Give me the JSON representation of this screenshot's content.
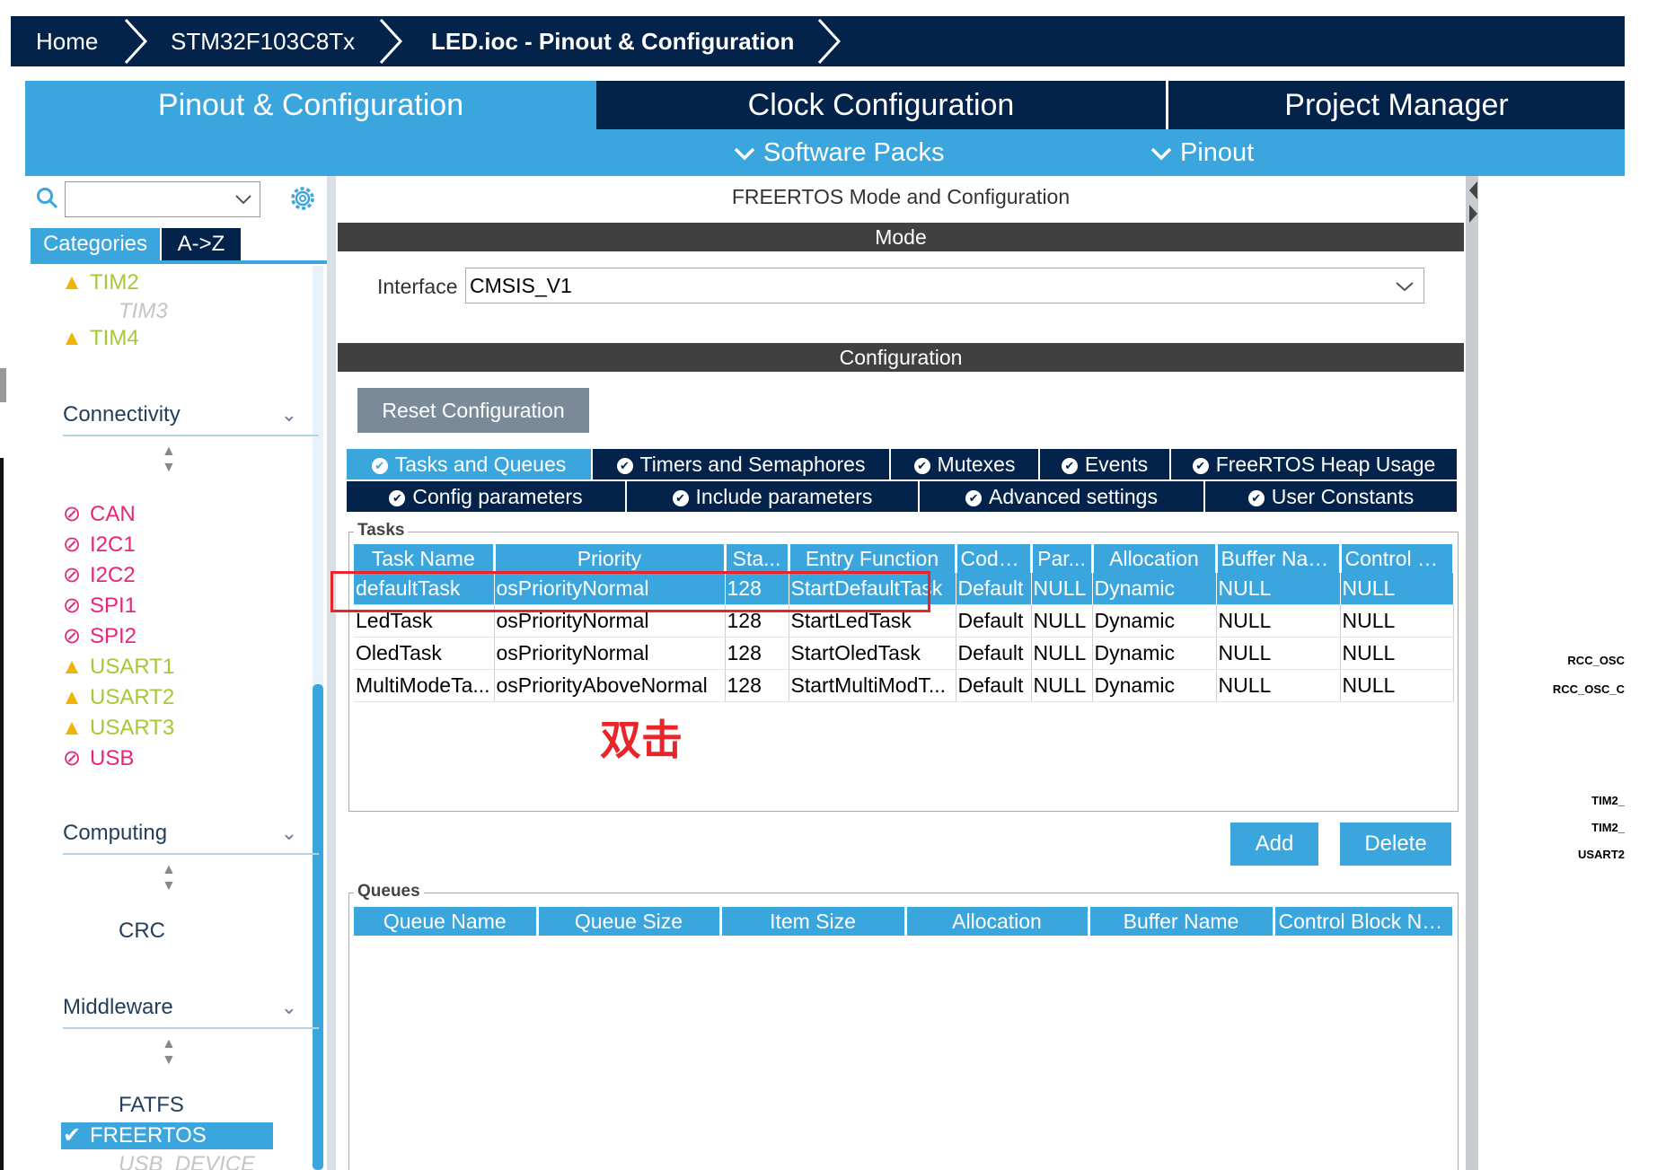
{
  "breadcrumb": [
    "Home",
    "STM32F103C8Tx",
    "LED.ioc - Pinout & Configuration"
  ],
  "top_tabs": [
    "Pinout & Configuration",
    "Clock Configuration",
    "Project Manager"
  ],
  "sub_menu": [
    "Software Packs",
    "Pinout"
  ],
  "left": {
    "search_value": "",
    "category_tabs": [
      "Categories",
      "A->Z"
    ],
    "timers": [
      {
        "label": "TIM2",
        "state": "warning"
      },
      {
        "label": "TIM3",
        "state": "disabled"
      },
      {
        "label": "TIM4",
        "state": "warning"
      }
    ],
    "sections": {
      "connectivity": "Connectivity",
      "computing": "Computing",
      "middleware": "Middleware"
    },
    "connectivity": [
      {
        "label": "CAN",
        "state": "blocked"
      },
      {
        "label": "I2C1",
        "state": "blocked"
      },
      {
        "label": "I2C2",
        "state": "blocked"
      },
      {
        "label": "SPI1",
        "state": "blocked"
      },
      {
        "label": "SPI2",
        "state": "blocked"
      },
      {
        "label": "USART1",
        "state": "warning"
      },
      {
        "label": "USART2",
        "state": "warning"
      },
      {
        "label": "USART3",
        "state": "warning"
      },
      {
        "label": "USB",
        "state": "blocked"
      }
    ],
    "computing": [
      "CRC"
    ],
    "middleware": [
      {
        "label": "FATFS",
        "state": "normal"
      },
      {
        "label": "FREERTOS",
        "state": "selected"
      },
      {
        "label": "USB_DEVICE",
        "state": "disabled"
      }
    ]
  },
  "main": {
    "title": "FREERTOS Mode and Configuration",
    "mode_header": "Mode",
    "interface_label": "Interface",
    "interface_value": "CMSIS_V1",
    "config_header": "Configuration",
    "reset_button": "Reset Configuration",
    "tabs_row1": [
      "Tasks and Queues",
      "Timers and Semaphores",
      "Mutexes",
      "Events",
      "FreeRTOS Heap Usage"
    ],
    "tabs_row2": [
      "Config parameters",
      "Include parameters",
      "Advanced settings",
      "User Constants"
    ],
    "tasks_legend": "Tasks",
    "task_columns": [
      "Task Name",
      "Priority",
      "Sta...",
      "Entry Function",
      "Code...",
      "Par...",
      "Allocation",
      "Buffer Name",
      "Control Bl..."
    ],
    "tasks": [
      [
        "defaultTask",
        "osPriorityNormal",
        "128",
        "StartDefaultTask",
        "Default",
        "NULL",
        "Dynamic",
        "NULL",
        "NULL"
      ],
      [
        "LedTask",
        "osPriorityNormal",
        "128",
        "StartLedTask",
        "Default",
        "NULL",
        "Dynamic",
        "NULL",
        "NULL"
      ],
      [
        "OledTask",
        "osPriorityNormal",
        "128",
        "StartOledTask",
        "Default",
        "NULL",
        "Dynamic",
        "NULL",
        "NULL"
      ],
      [
        "MultiModeTa...",
        "osPriorityAboveNormal",
        "128",
        "StartMultiModT...",
        "Default",
        "NULL",
        "Dynamic",
        "NULL",
        "NULL"
      ]
    ],
    "annotation": "双击",
    "add_button": "Add",
    "delete_button": "Delete",
    "queues_legend": "Queues",
    "queue_columns": [
      "Queue Name",
      "Queue Size",
      "Item Size",
      "Allocation",
      "Buffer Name",
      "Control Block Na..."
    ]
  },
  "right_pins": [
    "RCC_OSC",
    "RCC_OSC_C",
    "TIM2_",
    "TIM2_",
    "USART2"
  ],
  "colors": {
    "navy": "#03234b",
    "accent": "#3ba5dd",
    "warning_text": "#a5c839",
    "blocked": "#e8247b",
    "band": "#404040",
    "annotation": "#e8262a"
  }
}
